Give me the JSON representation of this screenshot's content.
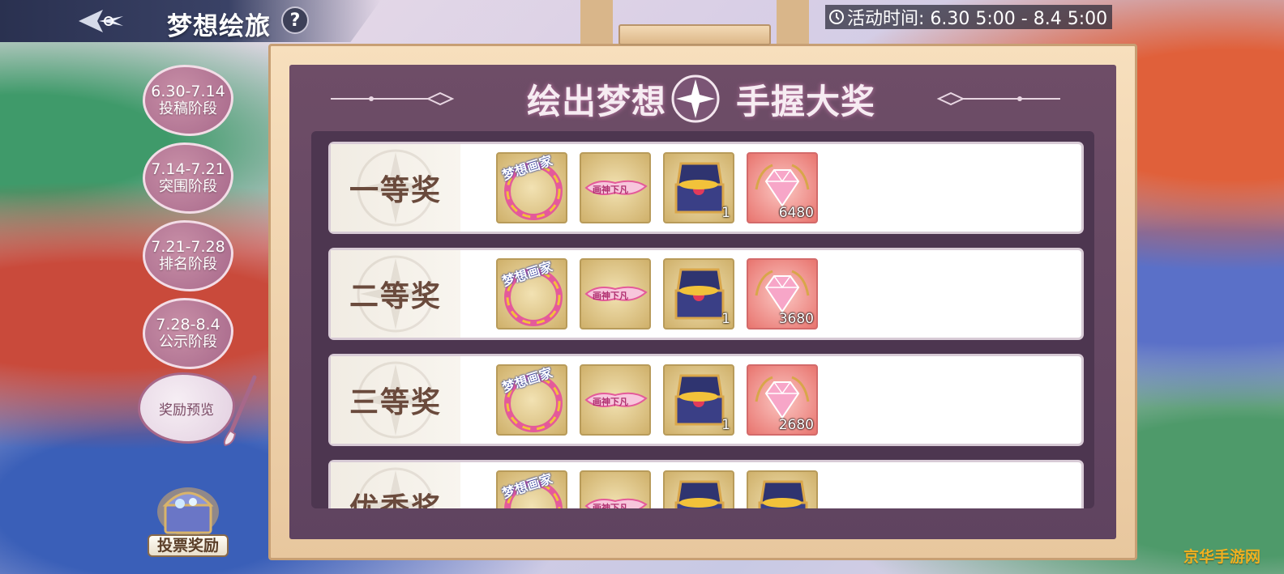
{
  "header": {
    "title": "梦想绘旅",
    "help_label": "?",
    "event_time": "活动时间: 6.30 5:00 - 8.4 5:00"
  },
  "sidebar": {
    "stages": [
      {
        "date": "6.30-7.14",
        "name": "投稿阶段"
      },
      {
        "date": "7.14-7.21",
        "name": "突围阶段"
      },
      {
        "date": "7.21-7.28",
        "name": "排名阶段"
      },
      {
        "date": "7.28-8.4",
        "name": "公示阶段"
      }
    ],
    "preview_label": "奖励预览",
    "vote_reward_label": "投票奖励"
  },
  "board": {
    "title_part1": "绘出梦想",
    "title_part2": "手握大奖",
    "frame_text": "梦想画家",
    "nameplate_text": "画神下凡",
    "prizes": [
      {
        "tier": "一等奖",
        "chest_qty": "1",
        "gem_qty": "6480"
      },
      {
        "tier": "二等奖",
        "chest_qty": "1",
        "gem_qty": "3680"
      },
      {
        "tier": "三等奖",
        "chest_qty": "1",
        "gem_qty": "2680"
      },
      {
        "tier": "优秀奖",
        "chest_qty": "",
        "gem_qty": ""
      }
    ]
  },
  "icons": {
    "logo": "winged-star-logo",
    "clock": "clock-icon",
    "frame": "avatar-frame-icon",
    "nameplate": "title-plate-icon",
    "chest": "treasure-chest-icon",
    "gem": "pink-diamond-icon"
  },
  "watermark": "京华手游网"
}
